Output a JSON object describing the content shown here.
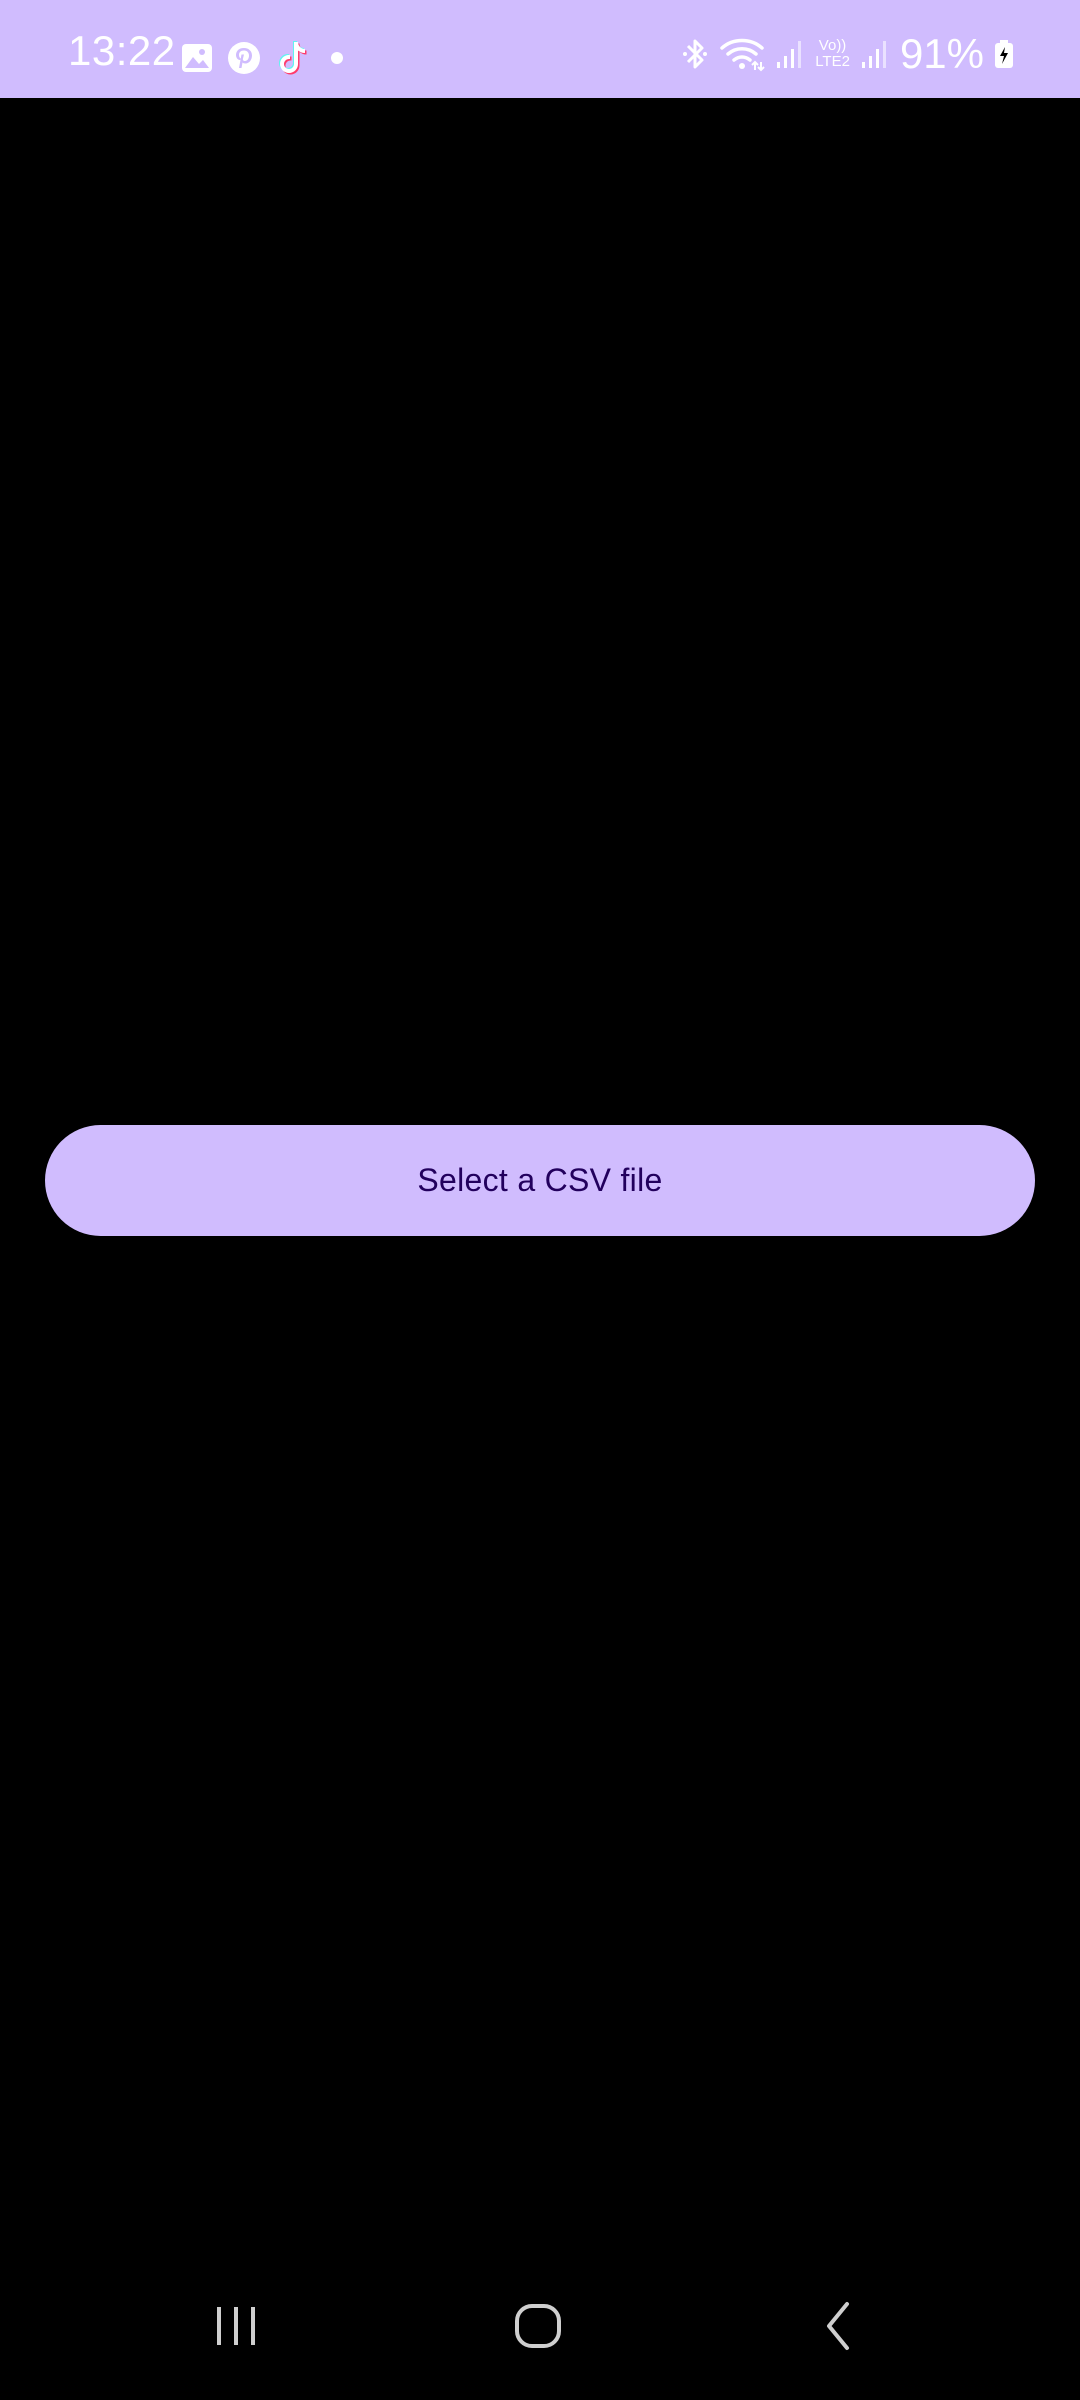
{
  "status_bar": {
    "time": "13:22",
    "battery": "91%",
    "network_label_top": "Vo))",
    "network_label_bottom": "LTE2",
    "background": "#d0bcfe",
    "icons": [
      "gallery-icon",
      "pinterest-icon",
      "tiktok-icon",
      "dot-icon",
      "bluetooth-icon",
      "wifi-icon",
      "signal-icon",
      "signal-icon-2",
      "battery-charging-icon"
    ]
  },
  "main": {
    "select_button_label": "Select a CSV file",
    "button_color": "#d0bcfe",
    "button_text_color": "#22005d",
    "background": "#000000"
  },
  "nav_bar": {
    "items": [
      "recents-icon",
      "home-icon",
      "back-icon"
    ]
  }
}
